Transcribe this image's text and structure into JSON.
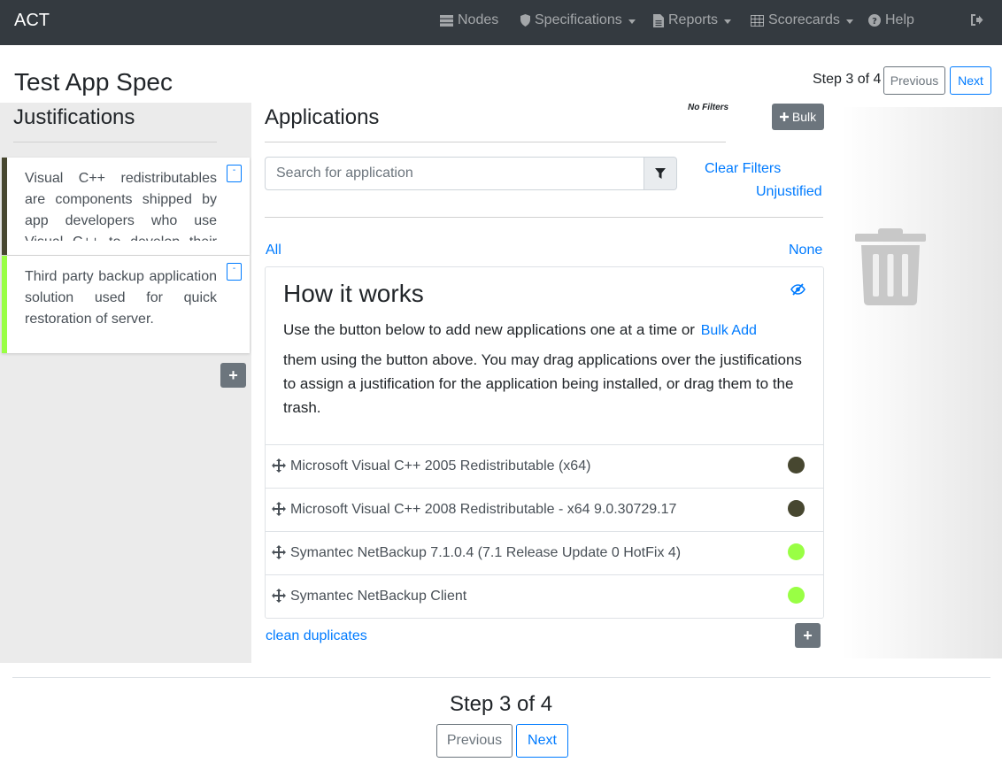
{
  "navbar": {
    "brand": "ACT",
    "items": [
      {
        "label": "Nodes",
        "icon": "server-icon"
      },
      {
        "label": "Specifications",
        "icon": "shield-icon"
      },
      {
        "label": "Reports",
        "icon": "file-icon"
      },
      {
        "label": "Scorecards",
        "icon": "table-icon"
      },
      {
        "label": "Help",
        "icon": "question-circle-icon"
      }
    ],
    "signout_icon": "sign-out-icon"
  },
  "header": {
    "title": "Test App Spec",
    "step": "Step 3 of 4",
    "previous": "Previous",
    "next": "Next"
  },
  "justifications": {
    "title": "Justifications",
    "items": [
      {
        "text": "Visual C++ redistributables are components shipped by app developers who use Visual C++ to develop their applications.",
        "color": "#474730",
        "remove": "-"
      },
      {
        "text": "Third party backup application solution used for quick restoration of server.",
        "color": "#99ff44",
        "remove": "-"
      }
    ],
    "add": "+"
  },
  "applications": {
    "title": "Applications",
    "filters_status": "No Filters",
    "bulk": "Bulk",
    "search_placeholder": "Search for application",
    "clear_filters": "Clear Filters",
    "unjustified": "Unjustified",
    "all": "All",
    "none": "None",
    "how_title": "How it works",
    "how_text_1": "Use the button below to add new applications one at a time or",
    "bulk_add": "Bulk Add",
    "how_text_2": "them using the button above. You may drag applications over the justifications to assign a justification for the application being installed, or drag them to the trash.",
    "rows": [
      {
        "name": "Microsoft Visual C++ 2005 Redistributable (x64)",
        "color": "#474730"
      },
      {
        "name": "Microsoft Visual C++ 2008 Redistributable - x64 9.0.30729.17",
        "color": "#474730"
      },
      {
        "name": "Symantec NetBackup 7.1.0.4 (7.1 Release Update 0 HotFix 4)",
        "color": "#99ff44"
      },
      {
        "name": "Symantec NetBackup Client",
        "color": "#99ff44"
      }
    ],
    "clean_duplicates": "clean duplicates",
    "add": "+"
  },
  "footer": {
    "step": "Step 3 of 4",
    "previous": "Previous",
    "next": "Next"
  }
}
